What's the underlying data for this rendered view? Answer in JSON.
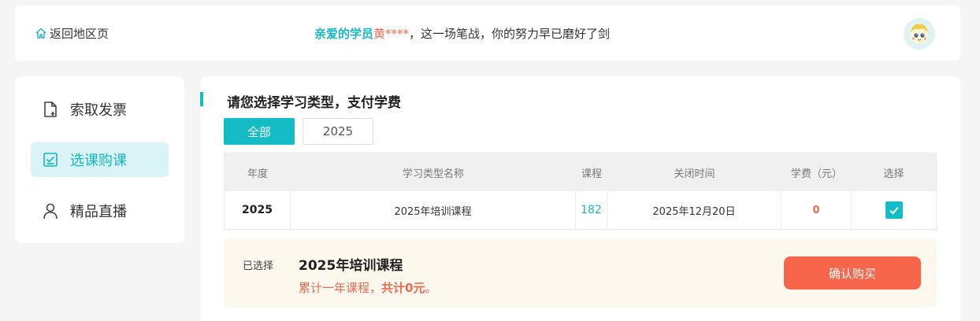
{
  "header": {
    "back_label": "返回地区页",
    "greeting_prefix": "亲爱的学员",
    "greeting_name": "黄****",
    "greeting_text": "，这一场笔战，你的努力早已磨好了剑",
    "avatar_icon": "cartoon-avatar"
  },
  "sidebar": {
    "items": [
      {
        "label": "索取发票",
        "icon": "invoice-icon",
        "active": false
      },
      {
        "label": "选课购课",
        "icon": "checklist-icon",
        "active": true
      },
      {
        "label": "精品直播",
        "icon": "person-icon",
        "active": false
      }
    ]
  },
  "main": {
    "title": "请您选择学习类型，支付学费",
    "filters": [
      "全部",
      "2025"
    ],
    "active_filter": "全部",
    "table": {
      "headers": [
        "年度",
        "学习类型名称",
        "课程",
        "关闭时间",
        "学费（元）",
        "选择"
      ],
      "rows": [
        {
          "year": "2025",
          "name": "2025年培训课程",
          "courses": "182",
          "close_time": "2025年12月20日",
          "fee": "0",
          "selected": true
        }
      ]
    },
    "summary": {
      "label": "已选择",
      "title": "2025年培训课程",
      "desc_prefix": "累计一年课程，",
      "desc_bold": "共计0元",
      "desc_suffix": "。",
      "buy_label": "确认购买"
    }
  },
  "colors": {
    "accent": "#14bdc6",
    "orange": "#f7654a",
    "summary_bg": "#fdf8ee"
  }
}
